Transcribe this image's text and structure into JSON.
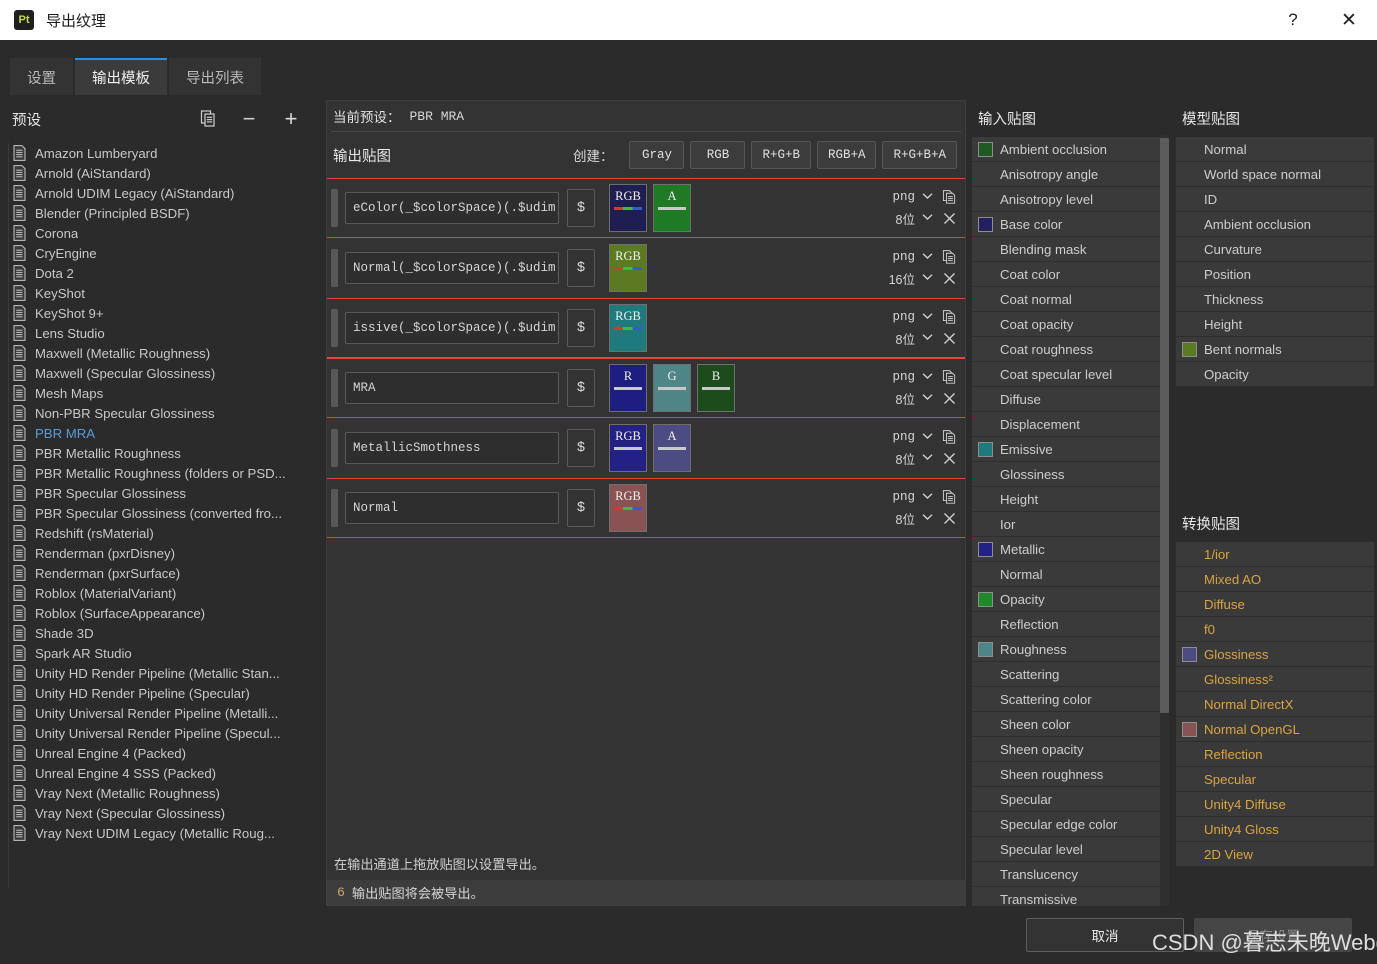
{
  "window": {
    "app_icon_label": "Pt",
    "title": "导出纹理",
    "help_label": "?",
    "close_label": "✕"
  },
  "tabs": [
    {
      "label": "设置",
      "active": false
    },
    {
      "label": "输出模板",
      "active": true
    },
    {
      "label": "导出列表",
      "active": false
    }
  ],
  "presets_panel": {
    "title": "预设",
    "duplicate_icon": "duplicate-icon",
    "remove_label": "−",
    "add_label": "+",
    "items": [
      {
        "label": "Amazon Lumberyard",
        "selected": false
      },
      {
        "label": "Arnold (AiStandard)",
        "selected": false
      },
      {
        "label": "Arnold UDIM Legacy (AiStandard)",
        "selected": false
      },
      {
        "label": "Blender (Principled BSDF)",
        "selected": false
      },
      {
        "label": "Corona",
        "selected": false
      },
      {
        "label": "CryEngine",
        "selected": false
      },
      {
        "label": "Dota 2",
        "selected": false
      },
      {
        "label": "KeyShot",
        "selected": false
      },
      {
        "label": "KeyShot 9+",
        "selected": false
      },
      {
        "label": "Lens Studio",
        "selected": false
      },
      {
        "label": "Maxwell (Metallic Roughness)",
        "selected": false
      },
      {
        "label": "Maxwell (Specular Glossiness)",
        "selected": false
      },
      {
        "label": "Mesh Maps",
        "selected": false
      },
      {
        "label": "Non-PBR Specular Glossiness",
        "selected": false
      },
      {
        "label": "PBR MRA",
        "selected": true
      },
      {
        "label": "PBR Metallic Roughness",
        "selected": false
      },
      {
        "label": "PBR Metallic Roughness (folders or PSD...",
        "selected": false
      },
      {
        "label": "PBR Specular Glossiness",
        "selected": false
      },
      {
        "label": "PBR Specular Glossiness (converted fro...",
        "selected": false
      },
      {
        "label": "Redshift (rsMaterial)",
        "selected": false
      },
      {
        "label": "Renderman (pxrDisney)",
        "selected": false
      },
      {
        "label": "Renderman (pxrSurface)",
        "selected": false
      },
      {
        "label": "Roblox (MaterialVariant)",
        "selected": false
      },
      {
        "label": "Roblox (SurfaceAppearance)",
        "selected": false
      },
      {
        "label": "Shade 3D",
        "selected": false
      },
      {
        "label": "Spark AR Studio",
        "selected": false
      },
      {
        "label": "Unity HD Render Pipeline (Metallic Stan...",
        "selected": false
      },
      {
        "label": "Unity HD Render Pipeline (Specular)",
        "selected": false
      },
      {
        "label": "Unity Universal Render Pipeline (Metalli...",
        "selected": false
      },
      {
        "label": "Unity Universal Render Pipeline (Specul...",
        "selected": false
      },
      {
        "label": "Unreal Engine 4 (Packed)",
        "selected": false
      },
      {
        "label": "Unreal Engine 4 SSS (Packed)",
        "selected": false
      },
      {
        "label": "Vray Next (Metallic Roughness)",
        "selected": false
      },
      {
        "label": "Vray Next (Specular Glossiness)",
        "selected": false
      },
      {
        "label": "Vray Next UDIM Legacy (Metallic Roug...",
        "selected": false
      }
    ]
  },
  "center": {
    "current_preset_label": "当前预设：",
    "current_preset_value": "PBR MRA",
    "output_maps_label": "输出贴图",
    "create_label": "创建：",
    "create_buttons": [
      "Gray",
      "RGB",
      "R+G+B",
      "RGB+A",
      "R+G+B+A"
    ],
    "rows": [
      {
        "filename": "eColor(_$colorSpace)(.$udim)",
        "dollar": "$",
        "format": "png",
        "depth": "8位",
        "highlighted": true,
        "channels": [
          {
            "name": "RGB",
            "bar": "rgb",
            "color": "#1e1e52"
          },
          {
            "name": "A",
            "bar": "solid",
            "color": "#1e7a24"
          }
        ]
      },
      {
        "filename": "Normal(_$colorSpace)(.$udim)",
        "dollar": "$",
        "format": "png",
        "depth": "16位",
        "highlighted": false,
        "channels": [
          {
            "name": "RGB",
            "bar": "rgb",
            "color": "#5c7a22"
          }
        ]
      },
      {
        "filename": "issive(_$colorSpace)(.$udim)",
        "dollar": "$",
        "format": "png",
        "depth": "8位",
        "highlighted": true,
        "channels": [
          {
            "name": "RGB",
            "bar": "rgb",
            "color": "#1f7a7d"
          }
        ]
      },
      {
        "filename": "MRA",
        "dollar": "$",
        "format": "png",
        "depth": "8位",
        "highlighted": true,
        "channels": [
          {
            "name": "R",
            "bar": "solid",
            "color": "#1e1e80"
          },
          {
            "name": "G",
            "bar": "solid",
            "color": "#4e8587"
          },
          {
            "name": "B",
            "bar": "solid",
            "color": "#1c4c1c"
          }
        ]
      },
      {
        "filename": "MetallicSmothness",
        "dollar": "$",
        "format": "png",
        "depth": "8位",
        "highlighted": false,
        "channels": [
          {
            "name": "RGB",
            "bar": "solid",
            "color": "#232184"
          },
          {
            "name": "A",
            "bar": "solid",
            "color": "#4c4c82"
          }
        ]
      },
      {
        "filename": "Normal",
        "dollar": "$",
        "format": "png",
        "depth": "8位",
        "highlighted": true,
        "channels": [
          {
            "name": "RGB",
            "bar": "rgb",
            "color": "#8a5353"
          }
        ]
      }
    ],
    "hint": "在输出通道上拖放贴图以设置导出。",
    "count_number": "6",
    "count_text": "输出贴图将会被导出。"
  },
  "input_maps": {
    "title": "输入贴图",
    "items": [
      {
        "label": "Ambient occlusion",
        "swatch": "#1f5a22"
      },
      {
        "label": "Anisotropy angle",
        "swatch": null
      },
      {
        "label": "Anisotropy level",
        "swatch": null
      },
      {
        "label": "Base color",
        "swatch": "#22205e"
      },
      {
        "label": "Blending mask",
        "swatch": null
      },
      {
        "label": "Coat color",
        "swatch": null
      },
      {
        "label": "Coat normal",
        "swatch": null
      },
      {
        "label": "Coat opacity",
        "swatch": null
      },
      {
        "label": "Coat roughness",
        "swatch": null
      },
      {
        "label": "Coat specular level",
        "swatch": null
      },
      {
        "label": "Diffuse",
        "swatch": null
      },
      {
        "label": "Displacement",
        "swatch": null
      },
      {
        "label": "Emissive",
        "swatch": "#1f7a7d"
      },
      {
        "label": "Glossiness",
        "swatch": null
      },
      {
        "label": "Height",
        "swatch": null
      },
      {
        "label": "Ior",
        "swatch": null
      },
      {
        "label": "Metallic",
        "swatch": "#232184"
      },
      {
        "label": "Normal",
        "swatch": null
      },
      {
        "label": "Opacity",
        "swatch": "#1e8a2a"
      },
      {
        "label": "Reflection",
        "swatch": null
      },
      {
        "label": "Roughness",
        "swatch": "#4e8587"
      },
      {
        "label": "Scattering",
        "swatch": null
      },
      {
        "label": "Scattering color",
        "swatch": null
      },
      {
        "label": "Sheen color",
        "swatch": null
      },
      {
        "label": "Sheen opacity",
        "swatch": null
      },
      {
        "label": "Sheen roughness",
        "swatch": null
      },
      {
        "label": "Specular",
        "swatch": null
      },
      {
        "label": "Specular edge color",
        "swatch": null
      },
      {
        "label": "Specular level",
        "swatch": null
      },
      {
        "label": "Translucency",
        "swatch": null
      },
      {
        "label": "Transmissive",
        "swatch": null
      }
    ]
  },
  "mesh_maps": {
    "title": "模型贴图",
    "items": [
      {
        "label": "Normal",
        "swatch": null
      },
      {
        "label": "World space normal",
        "swatch": null
      },
      {
        "label": "ID",
        "swatch": null
      },
      {
        "label": "Ambient occlusion",
        "swatch": null
      },
      {
        "label": "Curvature",
        "swatch": null
      },
      {
        "label": "Position",
        "swatch": null
      },
      {
        "label": "Thickness",
        "swatch": null
      },
      {
        "label": "Height",
        "swatch": null
      },
      {
        "label": "Bent normals",
        "swatch": "#5c7a22"
      },
      {
        "label": "Opacity",
        "swatch": null
      }
    ]
  },
  "converted_maps": {
    "title": "转换贴图",
    "items": [
      {
        "label": "1/ior",
        "swatch": null
      },
      {
        "label": "Mixed AO",
        "swatch": null
      },
      {
        "label": "Diffuse",
        "swatch": null
      },
      {
        "label": "f0",
        "swatch": null
      },
      {
        "label": "Glossiness",
        "swatch": "#4c4c82"
      },
      {
        "label": "Glossiness²",
        "swatch": null
      },
      {
        "label": "Normal DirectX",
        "swatch": null
      },
      {
        "label": "Normal OpenGL",
        "swatch": "#8a5353"
      },
      {
        "label": "Reflection",
        "swatch": null
      },
      {
        "label": "Specular",
        "swatch": null
      },
      {
        "label": "Unity4 Diffuse",
        "swatch": null
      },
      {
        "label": "Unity4 Gloss",
        "swatch": null
      },
      {
        "label": "2D View",
        "swatch": null
      }
    ]
  },
  "footer": {
    "cancel_label": "取消",
    "save_label": "保存设置"
  },
  "watermark": "CSDN @暮志未晚Webgl",
  "colors": {
    "accent": "#2a8fe0",
    "highlight_border": "#e8413a",
    "selected_text": "#5b9bd5",
    "gold_text": "#d9a441"
  }
}
